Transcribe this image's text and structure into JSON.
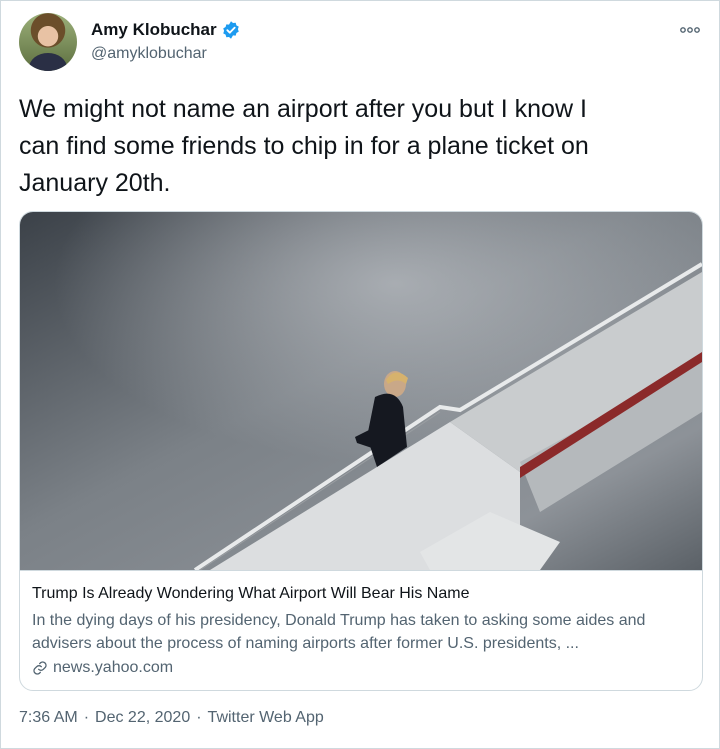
{
  "author": {
    "name": "Amy Klobuchar",
    "handle": "@amyklobuchar",
    "verified_icon": "verified-badge-icon",
    "more_icon": "more-horizontal-icon"
  },
  "tweet": {
    "text": "We might not name an airport after you but I know I\ncan find some friends to chip in for a plane ticket on\nJanuary 20th."
  },
  "card": {
    "title": "Trump Is Already Wondering What Airport Will Bear His Name",
    "description": "In the dying days of his presidency, Donald Trump has taken to asking some aides and advisers about the process of naming airports after former U.S. presidents, ...",
    "domain": "news.yahoo.com",
    "link_icon": "link-icon"
  },
  "meta": {
    "time": "7:36 AM",
    "date": "Dec 22, 2020",
    "source": "Twitter Web App",
    "separator": "·"
  },
  "colors": {
    "text": "#0f1419",
    "secondary": "#536471",
    "border": "#cfd9de",
    "verified": "#1d9bf0"
  }
}
